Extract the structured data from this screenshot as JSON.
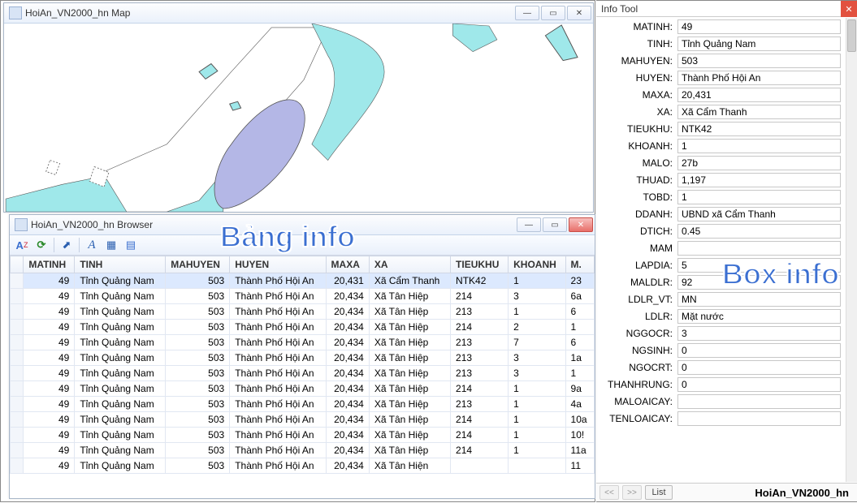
{
  "map_window": {
    "title": "HoiAn_VN2000_hn Map"
  },
  "browser_window": {
    "title": "HoiAn_VN2000_hn Browser"
  },
  "overlays": {
    "bang": "Bảng info",
    "box": "Box info"
  },
  "table": {
    "headers": [
      "MATINH",
      "TINH",
      "MAHUYEN",
      "HUYEN",
      "MAXA",
      "XA",
      "TIEUKHU",
      "KHOANH",
      "M."
    ],
    "rows": [
      [
        "49",
        "Tỉnh Quảng Nam",
        "503",
        "Thành Phố Hội An",
        "20,431",
        "Xã Cẩm Thanh",
        "NTK42",
        "1",
        "23"
      ],
      [
        "49",
        "Tỉnh Quảng Nam",
        "503",
        "Thành Phố Hội An",
        "20,434",
        "Xã Tân Hiệp",
        "214",
        "3",
        "6a"
      ],
      [
        "49",
        "Tỉnh Quảng Nam",
        "503",
        "Thành Phố Hội An",
        "20,434",
        "Xã Tân Hiệp",
        "213",
        "1",
        "6"
      ],
      [
        "49",
        "Tỉnh Quảng Nam",
        "503",
        "Thành Phố Hội An",
        "20,434",
        "Xã Tân Hiệp",
        "214",
        "2",
        "1"
      ],
      [
        "49",
        "Tỉnh Quảng Nam",
        "503",
        "Thành Phố Hội An",
        "20,434",
        "Xã Tân Hiệp",
        "213",
        "7",
        "6"
      ],
      [
        "49",
        "Tỉnh Quảng Nam",
        "503",
        "Thành Phố Hội An",
        "20,434",
        "Xã Tân Hiệp",
        "213",
        "3",
        "1a"
      ],
      [
        "49",
        "Tỉnh Quảng Nam",
        "503",
        "Thành Phố Hội An",
        "20,434",
        "Xã Tân Hiệp",
        "213",
        "3",
        "1"
      ],
      [
        "49",
        "Tỉnh Quảng Nam",
        "503",
        "Thành Phố Hội An",
        "20,434",
        "Xã Tân Hiệp",
        "214",
        "1",
        "9a"
      ],
      [
        "49",
        "Tỉnh Quảng Nam",
        "503",
        "Thành Phố Hội An",
        "20,434",
        "Xã Tân Hiệp",
        "213",
        "1",
        "4a"
      ],
      [
        "49",
        "Tỉnh Quảng Nam",
        "503",
        "Thành Phố Hội An",
        "20,434",
        "Xã Tân Hiệp",
        "214",
        "1",
        "10a"
      ],
      [
        "49",
        "Tỉnh Quảng Nam",
        "503",
        "Thành Phố Hội An",
        "20,434",
        "Xã Tân Hiệp",
        "214",
        "1",
        "10!"
      ],
      [
        "49",
        "Tỉnh Quảng Nam",
        "503",
        "Thành Phố Hội An",
        "20,434",
        "Xã Tân Hiệp",
        "214",
        "1",
        "11a"
      ],
      [
        "49",
        "Tỉnh Quảng Nam",
        "503",
        "Thành Phố Hội An",
        "20,434",
        "Xã Tân Hiện",
        "",
        "",
        "11"
      ]
    ],
    "numeric_cols": [
      0,
      2,
      4
    ]
  },
  "info_panel": {
    "title": "Info Tool",
    "footer_label": "HoiAn_VN2000_hn",
    "list_btn": "List",
    "fields": [
      {
        "label": "MATINH:",
        "value": "49"
      },
      {
        "label": "TINH:",
        "value": "Tỉnh Quảng Nam"
      },
      {
        "label": "MAHUYEN:",
        "value": "503"
      },
      {
        "label": "HUYEN:",
        "value": "Thành Phố Hội An"
      },
      {
        "label": "MAXA:",
        "value": "20,431"
      },
      {
        "label": "XA:",
        "value": "Xã Cẩm Thanh"
      },
      {
        "label": "TIEUKHU:",
        "value": "NTK42"
      },
      {
        "label": "KHOANH:",
        "value": "1"
      },
      {
        "label": "MALO:",
        "value": "27b"
      },
      {
        "label": "THUAD:",
        "value": "1,197"
      },
      {
        "label": "TOBD:",
        "value": "1"
      },
      {
        "label": "DDANH:",
        "value": "UBND xã  Cẩm Thanh"
      },
      {
        "label": "DTICH:",
        "value": "0.45"
      },
      {
        "label": "MAM",
        "value": ""
      },
      {
        "label": "LAPDIA:",
        "value": "5"
      },
      {
        "label": "MALDLR:",
        "value": "92"
      },
      {
        "label": "LDLR_VT:",
        "value": "MN"
      },
      {
        "label": "LDLR:",
        "value": "Mặt nước"
      },
      {
        "label": "NGGOCR:",
        "value": "3"
      },
      {
        "label": "NGSINH:",
        "value": "0"
      },
      {
        "label": "NGOCRT:",
        "value": "0"
      },
      {
        "label": "THANHRUNG:",
        "value": "0"
      },
      {
        "label": "MALOAICAY:",
        "value": ""
      },
      {
        "label": "TENLOAICAY:",
        "value": ""
      }
    ]
  }
}
